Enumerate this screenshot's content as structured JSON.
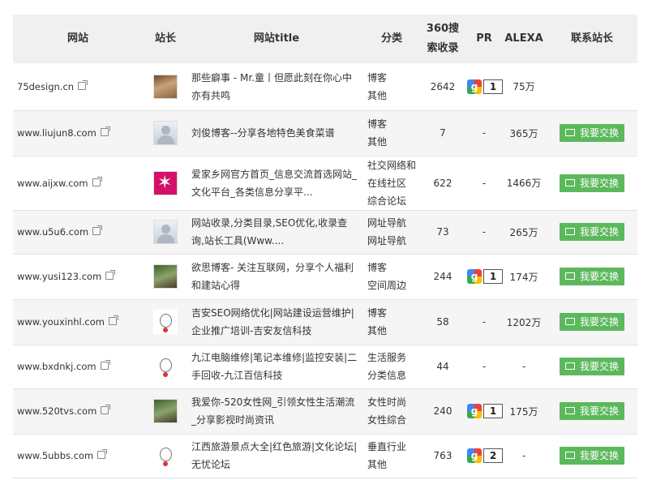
{
  "headers": {
    "site": "网站",
    "owner": "站长",
    "title": "网站title",
    "category": "分类",
    "indexed": "360搜\n索收录",
    "pr": "PR",
    "alexa": "ALEXA",
    "contact": "联系站长"
  },
  "contact_button_label": "我要交换",
  "rows": [
    {
      "site": "75design.cn",
      "avatar": "photo",
      "title": "那些癖事 - Mr.童丨但愿此刻在你心中亦有共鸣",
      "category": "博客\n其他",
      "indexed": "2642",
      "pr": "1",
      "alexa": "75万",
      "button": false
    },
    {
      "site": "www.liujun8.com",
      "avatar": "default",
      "title": "刘俊博客--分享各地特色美食菜谱",
      "category": "博客\n其他",
      "indexed": "7",
      "pr": "-",
      "alexa": "365万",
      "button": true
    },
    {
      "site": "www.aijxw.com",
      "avatar": "pink",
      "title": "爱家乡网官方首页_信息交流首选网站_文化平台_各类信息分享平...",
      "category": "社交网络和\n在线社区\n综合论坛",
      "indexed": "622",
      "pr": "-",
      "alexa": "1466万",
      "button": true
    },
    {
      "site": "www.u5u6.com",
      "avatar": "default",
      "title": "网站收录,分类目录,SEO优化,收录查询,站长工具(Www....",
      "category": "网址导航\n网址导航",
      "indexed": "73",
      "pr": "-",
      "alexa": "265万",
      "button": true
    },
    {
      "site": "www.yusi123.com",
      "avatar": "outdoor",
      "title": "欲思博客- 关注互联网，分享个人福利和建站心得",
      "category": "博客\n空间周边",
      "indexed": "244",
      "pr": "1",
      "alexa": "174万",
      "button": true
    },
    {
      "site": "www.youxinhl.com",
      "avatar": "cartoon",
      "title": "吉安SEO网络优化|网站建设运营维护|企业推广培训-吉安友信科技",
      "category": "博客\n其他",
      "indexed": "58",
      "pr": "-",
      "alexa": "1202万",
      "button": true
    },
    {
      "site": "www.bxdnkj.com",
      "avatar": "cartoon",
      "title": "九江电脑维修|笔记本维修|监控安装|二手回收-九江百信科技",
      "category": "生活服务\n分类信息",
      "indexed": "44",
      "pr": "-",
      "alexa": "-",
      "button": true
    },
    {
      "site": "www.520tvs.com",
      "avatar": "outdoor",
      "title": "我爱你-520女性网_引领女性生活潮流_分享影视时尚资讯",
      "category": "女性时尚\n女性综合",
      "indexed": "240",
      "pr": "1",
      "alexa": "175万",
      "button": true
    },
    {
      "site": "www.5ubbs.com",
      "avatar": "cartoon",
      "title": "江西旅游景点大全|红色旅游|文化论坛|无忧论坛",
      "category": "垂直行业\n其他",
      "indexed": "763",
      "pr": "2",
      "alexa": "-",
      "button": true
    }
  ],
  "colors": {
    "button_green": "#5cb85c",
    "header_bg": "#f0f0f0",
    "alt_row_bg": "#f5f5f5"
  },
  "icons": {
    "external_link": "external-link-icon",
    "google_pr": "google-pr-icon",
    "mail": "mail-icon"
  }
}
